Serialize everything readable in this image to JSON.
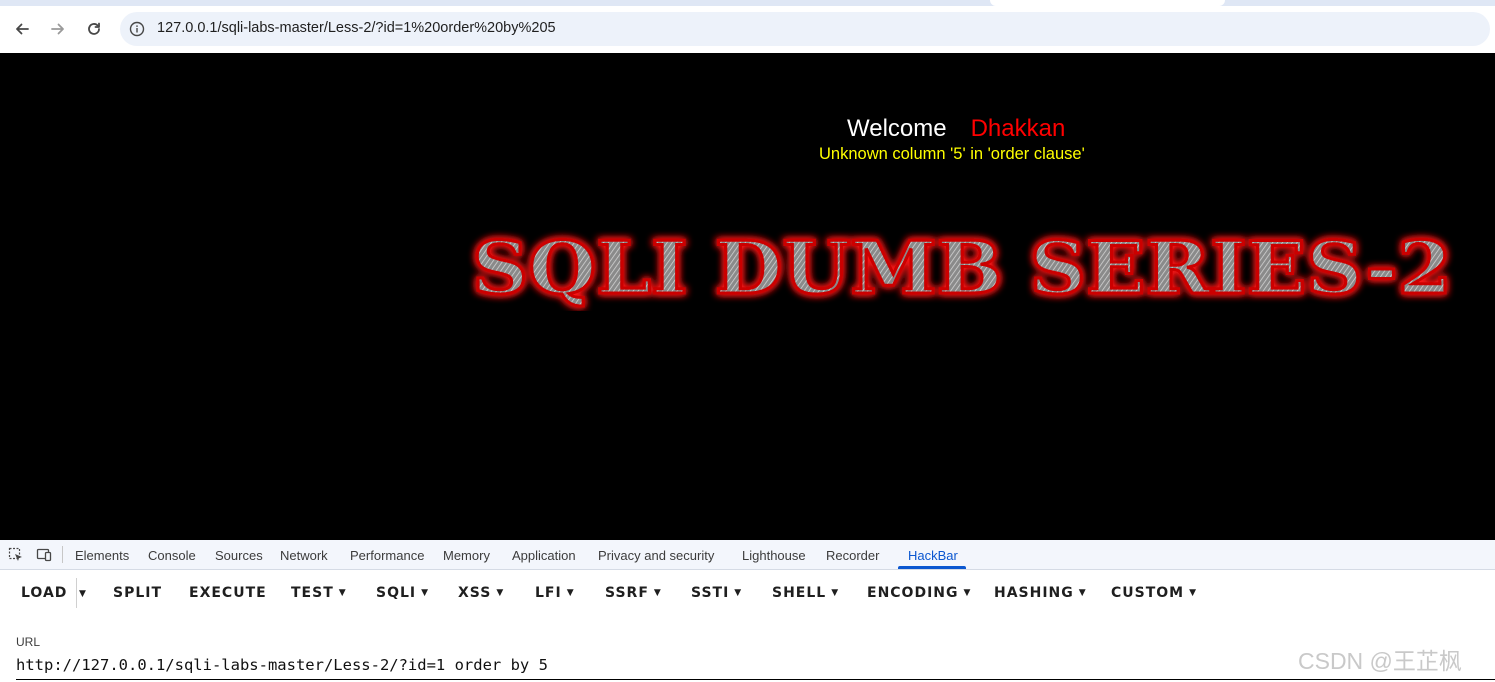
{
  "browser": {
    "url": "127.0.0.1/sqli-labs-master/Less-2/?id=1%20order%20by%205"
  },
  "page": {
    "welcome": "Welcome",
    "username": "Dhakkan",
    "error_message": "Unknown column '5' in 'order clause'",
    "banner_title": "SQLI DUMB SERIES-2"
  },
  "devtools": {
    "tabs": [
      "Elements",
      "Console",
      "Sources",
      "Network",
      "Performance",
      "Memory",
      "Application",
      "Privacy and security",
      "Lighthouse",
      "Recorder",
      "HackBar"
    ],
    "active_tab": "HackBar"
  },
  "hackbar": {
    "buttons": [
      "LOAD",
      "SPLIT",
      "EXECUTE",
      "TEST",
      "SQLI",
      "XSS",
      "LFI",
      "SSRF",
      "SSTI",
      "SHELL",
      "ENCODING",
      "HASHING",
      "CUSTOM"
    ],
    "url_label": "URL",
    "url_value": "http://127.0.0.1/sqli-labs-master/Less-2/?id=1 order by 5"
  },
  "watermark": "CSDN @王芷枫",
  "colors": {
    "page_background": "#000000",
    "welcome": "#ffffff",
    "username": "#ff0000",
    "error": "#ffff00",
    "accent": "#0b57d0"
  }
}
